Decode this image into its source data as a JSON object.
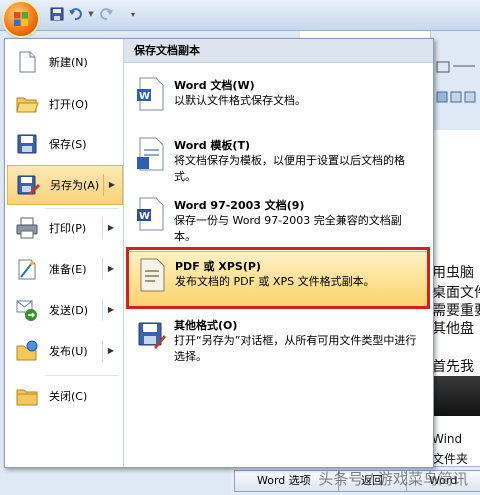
{
  "qat": {
    "icons": [
      "save-icon",
      "undo-icon",
      "redo-icon",
      "customize-icon"
    ]
  },
  "menu": {
    "left_items": [
      {
        "label": "新建(N)",
        "icon": "new-document-icon"
      },
      {
        "label": "打开(O)",
        "icon": "open-folder-icon"
      },
      {
        "label": "保存(S)",
        "icon": "save-icon"
      },
      {
        "label": "另存为(A)",
        "icon": "save-as-icon",
        "has_submenu": true,
        "selected": true
      },
      {
        "label": "打印(P)",
        "icon": "printer-icon",
        "has_submenu": true
      },
      {
        "label": "准备(E)",
        "icon": "prepare-icon",
        "has_submenu": true
      },
      {
        "label": "发送(D)",
        "icon": "send-icon",
        "has_submenu": true
      },
      {
        "label": "发布(U)",
        "icon": "publish-icon",
        "has_submenu": true
      },
      {
        "label": "关闭(C)",
        "icon": "close-folder-icon"
      }
    ],
    "right_header": "保存文档副本",
    "right_items": [
      {
        "title": "Word 文档(W)",
        "desc": "以默认文件格式保存文档。"
      },
      {
        "title": "Word 模板(T)",
        "desc": "将文档保存为模板，以便用于设置以后文档的格式。"
      },
      {
        "title": "Word 97-2003 文档(9)",
        "desc": "保存一份与 Word 97-2003 完全兼容的文档副本。"
      },
      {
        "title": "PDF 或 XPS(P)",
        "desc": "发布文档的 PDF 或 XPS 文件格式副本。",
        "selected": true
      },
      {
        "title": "其他格式(O)",
        "desc": "打开“另存为”对话框，从所有可用文件类型中进行选择。"
      }
    ]
  },
  "document": {
    "lines": [
      "用虫脑",
      "桌面文件",
      "需要重要",
      "其他盘",
      "首先我",
      "Wind",
      "文件夹"
    ]
  },
  "taskbar": {
    "buttons": [
      "Word 选项",
      "返回",
      "Word"
    ]
  },
  "watermark": "头条号 / 游戏菜鸟简讯",
  "colors": {
    "selected_bg": "#fbd878",
    "highlight_border": "#d42020",
    "header_bg": "#dde4ee"
  }
}
